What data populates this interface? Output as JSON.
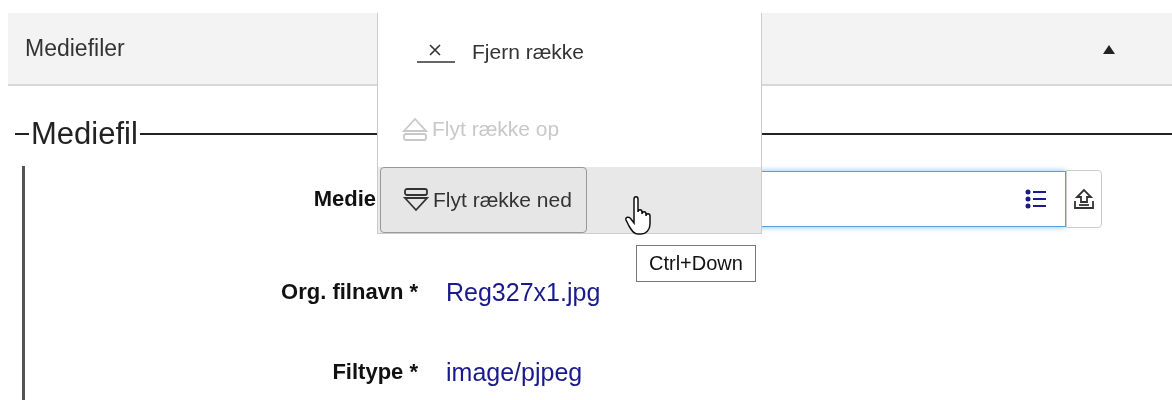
{
  "panel": {
    "title": "Mediefiler",
    "expanded": true
  },
  "fieldset": {
    "legend": "Mediefil"
  },
  "fields": [
    {
      "kind": "input",
      "label": "Medie",
      "focused": true
    },
    {
      "kind": "text",
      "label": "Org. filnavn *",
      "value": "Reg327x1.jpg"
    },
    {
      "kind": "text",
      "label": "Filtype *",
      "value": "image/pjpeg"
    }
  ],
  "context_menu": {
    "items": [
      {
        "kind": "remove",
        "label": "Fjern række",
        "disabled": false,
        "selected": false
      },
      {
        "kind": "up",
        "label": "Flyt række op",
        "disabled": true,
        "selected": false
      },
      {
        "kind": "down",
        "label": "Flyt række ned",
        "disabled": false,
        "selected": true
      }
    ]
  },
  "tooltip": "Ctrl+Down"
}
